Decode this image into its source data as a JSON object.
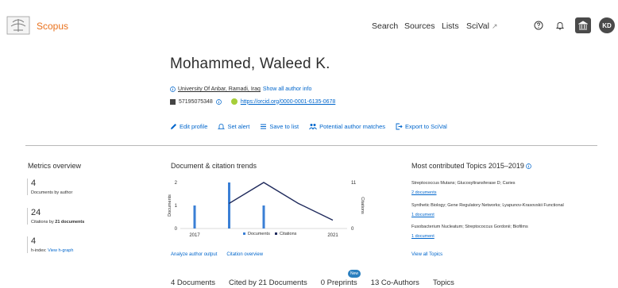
{
  "header": {
    "brand": "Scopus",
    "nav": {
      "search": "Search",
      "sources": "Sources",
      "lists": "Lists",
      "scival": "SciVal",
      "scival_ext": "↗"
    },
    "avatar_initials": "KD"
  },
  "author": {
    "name": "Mohammed, Waleed K.",
    "affiliation": "University Of Anbar, Ramadi, Iraq",
    "show_all_info": "Show all author info",
    "scopus_id": "57195075348",
    "orcid": "https://orcid.org/0000-0001-6135-0678"
  },
  "actions": {
    "edit_profile": "Edit profile",
    "set_alert": "Set alert",
    "save_to_list": "Save to list",
    "potential_matches": "Potential author matches",
    "export_scival": "Export to SciVal"
  },
  "metrics": {
    "title": "Metrics overview",
    "documents_value": "4",
    "documents_label": "Documents by author",
    "citations_value": "24",
    "citations_label_prefix": "Citations by",
    "citations_label_docs": "21 documents",
    "h_index_value": "4",
    "h_index_label": "h-index:",
    "view_h_graph": "View h-graph"
  },
  "chart": {
    "title": "Document & citation trends",
    "analyze_link": "Analyze author output",
    "citation_overview_link": "Citation overview"
  },
  "chart_data": {
    "type": "bar",
    "x_start": "2017",
    "x_end": "2021",
    "left_ylabel": "Documents",
    "right_ylabel": "Citations",
    "left_ticks": [
      "2",
      "1",
      "0"
    ],
    "right_ticks": [
      "11",
      "0"
    ],
    "left_ylim": [
      0,
      2
    ],
    "right_ylim": [
      0,
      11
    ],
    "x": [
      2017,
      2018,
      2019,
      2020,
      2021
    ],
    "series": [
      {
        "name": "Documents",
        "values": [
          1,
          2,
          1,
          0,
          0
        ],
        "color": "#3a7fd5"
      },
      {
        "name": "Citations",
        "values": [
          null,
          6,
          11,
          6,
          2
        ],
        "color": "#1f2a5c"
      }
    ]
  },
  "topics": {
    "title": "Most contributed Topics 2015–2019",
    "items": [
      {
        "name": "Streptococcus Mutans; Glucosyltransferase D; Caries",
        "docs": "2 documents"
      },
      {
        "name": "Synthetic Biology; Gene Regulatory Networks; Lyapunov-Krasovskii Functional",
        "docs": "1 document"
      },
      {
        "name": "Fusobacterium Nucleatum; Streptococcus Gordonii; Biofilms",
        "docs": "1 document"
      }
    ],
    "view_all": "View all Topics"
  },
  "tabs": {
    "documents": "4 Documents",
    "cited_by": "Cited by 21 Documents",
    "preprints": "0 Preprints",
    "new_badge": "New",
    "coauthors": "13 Co-Authors",
    "topics": "Topics"
  },
  "colors": {
    "accent": "#e9711c",
    "link": "#0066cc",
    "documents_bar": "#3a7fd5",
    "citations_line": "#1f2a5c"
  }
}
